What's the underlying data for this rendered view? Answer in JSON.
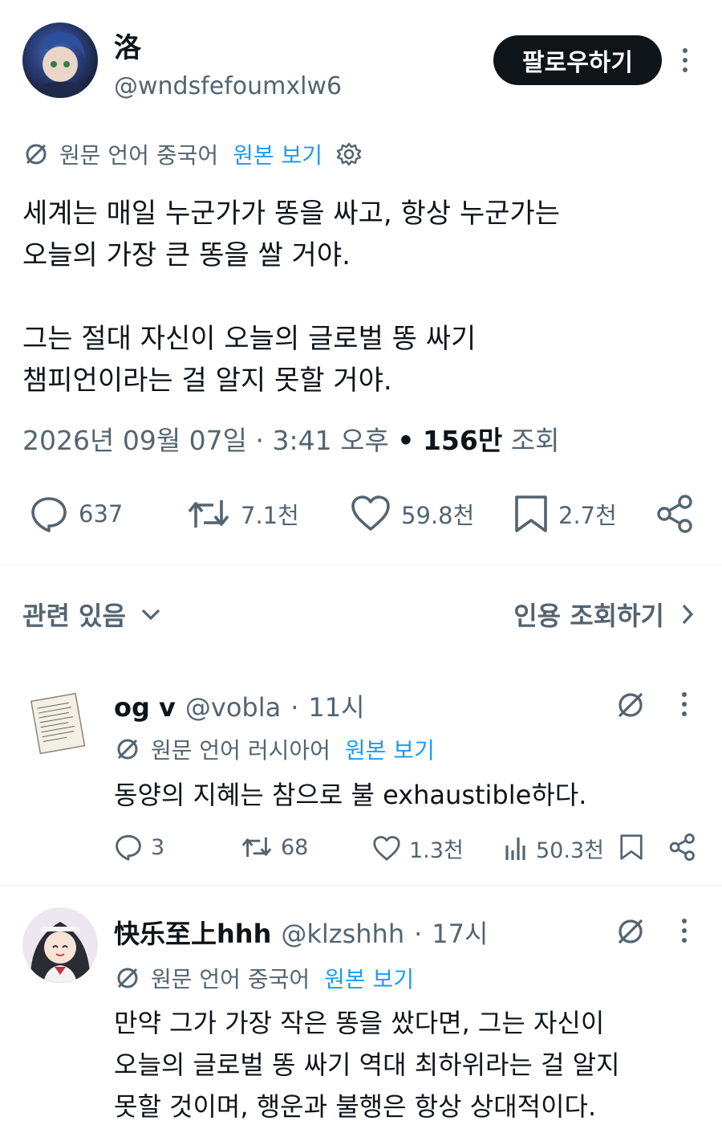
{
  "author": {
    "name": "洛",
    "handle": "@wndsfefoumxlw6"
  },
  "follow_label": "팔로우하기",
  "translation": {
    "source_text": "원문 언어 중국어",
    "view_original": "원본 보기"
  },
  "tweet": {
    "paragraph1_line1": "세계는 매일 누군가가 똥을 싸고, 항상 누군가는",
    "paragraph1_line2": "오늘의 가장 큰 똥을 쌀 거야.",
    "paragraph2_line1": "그는 절대 자신이 오늘의 글로벌 똥 싸기",
    "paragraph2_line2": "챔피언이라는 걸 알지 못할 거야."
  },
  "meta": {
    "date": "2026년 09월 07일",
    "sep1": "·",
    "time": "3:41 오후",
    "sep2": "•",
    "views": "156만",
    "views_label": "조회"
  },
  "stats": {
    "replies": "637",
    "retweets": "7.1천",
    "likes": "59.8천",
    "bookmarks": "2.7천"
  },
  "related": {
    "label": "관련 있음",
    "quote_view": "인용 조회하기"
  },
  "replies": [
    {
      "name": "og v",
      "handle": "@vobla",
      "sep": "·",
      "time": "11시",
      "translation_source": "원문 언어 러시아어",
      "view_original": "원본 보기",
      "text": "동양의 지혜는 참으로 불 exhaustible하다.",
      "stats": {
        "replies": "3",
        "retweets": "68",
        "likes": "1.3천",
        "views": "50.3천"
      }
    },
    {
      "name": "快乐至上hhh",
      "handle": "@klzshhh",
      "sep": "·",
      "time": "17시",
      "translation_source": "원문 언어 중국어",
      "view_original": "원본 보기",
      "text_line1": "만약 그가 가장 작은 똥을 쌌다면, 그는 자신이",
      "text_line2": "오늘의 글로벌 똥 싸기 역대 최하위라는 걸 알지",
      "text_line3": "못할 것이며, 행운과 불행은 항상 상대적이다."
    }
  ],
  "colors": {
    "text": "#0f1419",
    "muted": "#536471",
    "link": "#1d9bf0",
    "divider": "#eff3f4",
    "follow_bg": "#0f1419"
  },
  "icons": [
    "translate-icon",
    "gear-icon",
    "reply-icon",
    "retweet-icon",
    "like-icon",
    "bookmark-icon",
    "share-icon",
    "chevron-down-icon",
    "chevron-right-icon",
    "views-icon",
    "more-icon"
  ]
}
